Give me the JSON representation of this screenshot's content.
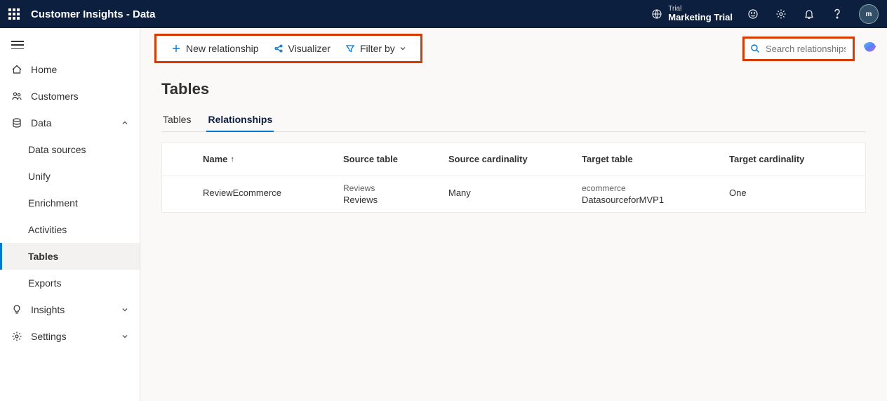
{
  "topbar": {
    "app_title": "Customer Insights - Data",
    "env_label": "Trial",
    "env_name": "Marketing Trial",
    "avatar_initials": "m"
  },
  "sidenav": {
    "home": "Home",
    "customers": "Customers",
    "data": "Data",
    "data_sources": "Data sources",
    "unify": "Unify",
    "enrichment": "Enrichment",
    "activities": "Activities",
    "tables": "Tables",
    "exports": "Exports",
    "insights": "Insights",
    "settings": "Settings"
  },
  "toolbar": {
    "new_relationship": "New relationship",
    "visualizer": "Visualizer",
    "filter_by": "Filter by",
    "search_placeholder": "Search relationships"
  },
  "page": {
    "title": "Tables",
    "tab_tables": "Tables",
    "tab_relationships": "Relationships"
  },
  "columns": {
    "name": "Name",
    "source_table": "Source table",
    "source_cardinality": "Source cardinality",
    "target_table": "Target table",
    "target_cardinality": "Target cardinality"
  },
  "rows": [
    {
      "name": "ReviewEcommerce",
      "source_sub": "Reviews",
      "source_main": "Reviews",
      "source_cardinality": "Many",
      "target_sub": "ecommerce",
      "target_main": "DatasourceforMVP1",
      "target_cardinality": "One"
    }
  ]
}
